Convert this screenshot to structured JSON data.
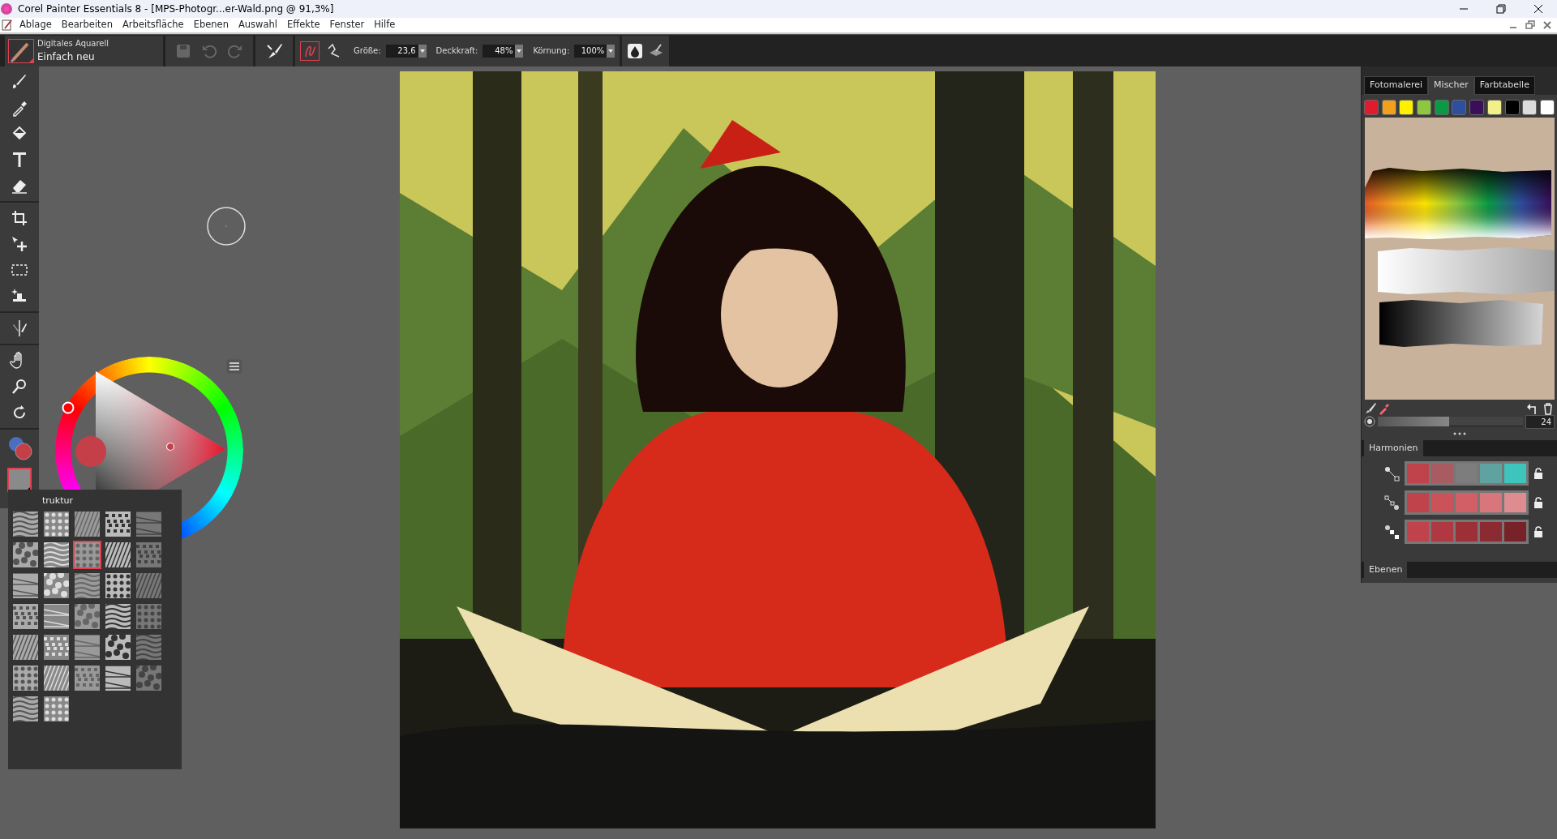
{
  "window": {
    "title": "Corel Painter Essentials 8 - [MPS-Photogr...er-Wald.png @ 91,3%]"
  },
  "menu": [
    "Ablage",
    "Bearbeiten",
    "Arbeitsfläche",
    "Ebenen",
    "Auswahl",
    "Effekte",
    "Fenster",
    "Hilfe"
  ],
  "brush": {
    "category": "Digitales Aquarell",
    "variant": "Einfach neu"
  },
  "stroke_modes": [
    {
      "kind": "freehand",
      "selected": true
    },
    {
      "kind": "straight",
      "selected": false
    }
  ],
  "properties": [
    {
      "label": "Größe:",
      "value": "23,6"
    },
    {
      "label": "Deckkraft:",
      "value": "48%"
    },
    {
      "label": "Körnung:",
      "value": "100%"
    }
  ],
  "tool_groups": [
    [
      {
        "kind": "brush"
      },
      {
        "kind": "dropper"
      },
      {
        "kind": "bucket"
      },
      {
        "kind": "text"
      },
      {
        "kind": "eraser"
      }
    ],
    [
      {
        "kind": "crop"
      },
      {
        "kind": "transform"
      },
      {
        "kind": "marquee"
      },
      {
        "kind": "clone"
      }
    ],
    [
      {
        "kind": "symmetry"
      }
    ],
    [
      {
        "kind": "hand"
      },
      {
        "kind": "magnifier"
      },
      {
        "kind": "rotate"
      }
    ]
  ],
  "colors": [
    {
      "kind": "additional",
      "color": "#4a6fc0"
    },
    {
      "kind": "main",
      "color": "#c43f48"
    }
  ],
  "textures": {
    "title": "truktur",
    "items": [
      {
        "selected": false
      },
      {
        "selected": false
      },
      {
        "selected": false
      },
      {
        "selected": false
      },
      {
        "selected": false
      },
      {
        "selected": false
      },
      {
        "selected": false
      },
      {
        "selected": true
      },
      {
        "selected": false
      },
      {
        "selected": false
      },
      {
        "selected": false
      },
      {
        "selected": false
      },
      {
        "selected": false
      },
      {
        "selected": false
      },
      {
        "selected": false
      },
      {
        "selected": false
      },
      {
        "selected": false
      },
      {
        "selected": false
      },
      {
        "selected": false
      },
      {
        "selected": false
      },
      {
        "selected": false
      },
      {
        "selected": false
      },
      {
        "selected": false
      },
      {
        "selected": false
      },
      {
        "selected": false
      },
      {
        "selected": false
      },
      {
        "selected": false
      },
      {
        "selected": false
      },
      {
        "selected": false
      },
      {
        "selected": false
      },
      {
        "selected": false
      },
      {
        "selected": false
      }
    ]
  },
  "canvas": {
    "kind": "picture"
  },
  "mixer": {
    "tabs": [
      {
        "label": "Fotomalerei",
        "selected": false
      },
      {
        "label": "Mischer",
        "selected": true
      },
      {
        "label": "Farbtabelle",
        "selected": false
      }
    ],
    "swatches": [
      {
        "color": "#e01b2e"
      },
      {
        "color": "#f0a01a"
      },
      {
        "color": "#fff000"
      },
      {
        "color": "#8dc63f"
      },
      {
        "color": "#0a9a45"
      },
      {
        "color": "#2e4f9e"
      },
      {
        "color": "#3a0f5a"
      },
      {
        "color": "#f3f08a"
      },
      {
        "color": "#000000"
      },
      {
        "color": "#dcdcdc"
      },
      {
        "color": "#ffffff"
      }
    ],
    "brush_size": {
      "level": 0.49,
      "value": "24"
    }
  },
  "harmonies": {
    "title": "Harmonien",
    "rows": [
      {
        "kind": "line",
        "cells": [
          {
            "color": "#c0434b"
          },
          {
            "color": "#a85c62"
          },
          {
            "color": "#7d7d7d"
          },
          {
            "color": "#5fa3a1"
          },
          {
            "color": "#3cc4bd"
          }
        ]
      },
      {
        "kind": "zigzag",
        "cells": [
          {
            "color": "#c0434b"
          },
          {
            "color": "#cc5259"
          },
          {
            "color": "#d25f66"
          },
          {
            "color": "#d8767b"
          },
          {
            "color": "#de8c90"
          }
        ]
      },
      {
        "kind": "steps",
        "cells": [
          {
            "color": "#c0434b"
          },
          {
            "color": "#b03840"
          },
          {
            "color": "#9d2f36"
          },
          {
            "color": "#8b2a31"
          },
          {
            "color": "#772228"
          }
        ]
      }
    ]
  },
  "layers": {
    "title": "Ebenen"
  }
}
